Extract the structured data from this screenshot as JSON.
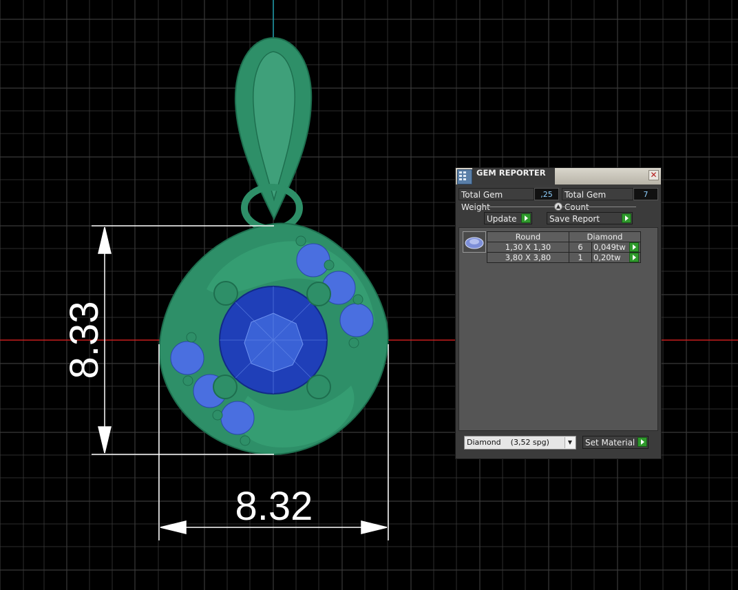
{
  "viewport": {
    "dimension_vertical": "8.33",
    "dimension_horizontal": "8.32",
    "colors": {
      "background": "#000000",
      "grid": "#3a3a3a",
      "metal": "#2e8f68",
      "center_stone": "#1f3fb8",
      "side_stones": "#4a6fe0",
      "x_axis": "#c81e1e",
      "y_axis": "#1fa0b0",
      "dimension_lines": "#ffffff"
    }
  },
  "gem_reporter": {
    "title": "GEM REPORTER",
    "close_icon": "close-icon",
    "total_weight_label": "Total Gem Weight",
    "total_weight_value": ",25",
    "total_count_label": "Total Gem Count",
    "total_count_value": "7",
    "update_label": "Update",
    "save_report_label": "Save Report",
    "table": {
      "headers": [
        "Round",
        "Diamond"
      ],
      "rows": [
        {
          "size": "1,30 X 1,30",
          "count": "6",
          "weight": "0,049tw"
        },
        {
          "size": "3,80 X 3,80",
          "count": "1",
          "weight": "0,20tw"
        }
      ]
    },
    "material_selected": "Diamond    (3,52 spg)",
    "set_material_label": "Set Material"
  }
}
